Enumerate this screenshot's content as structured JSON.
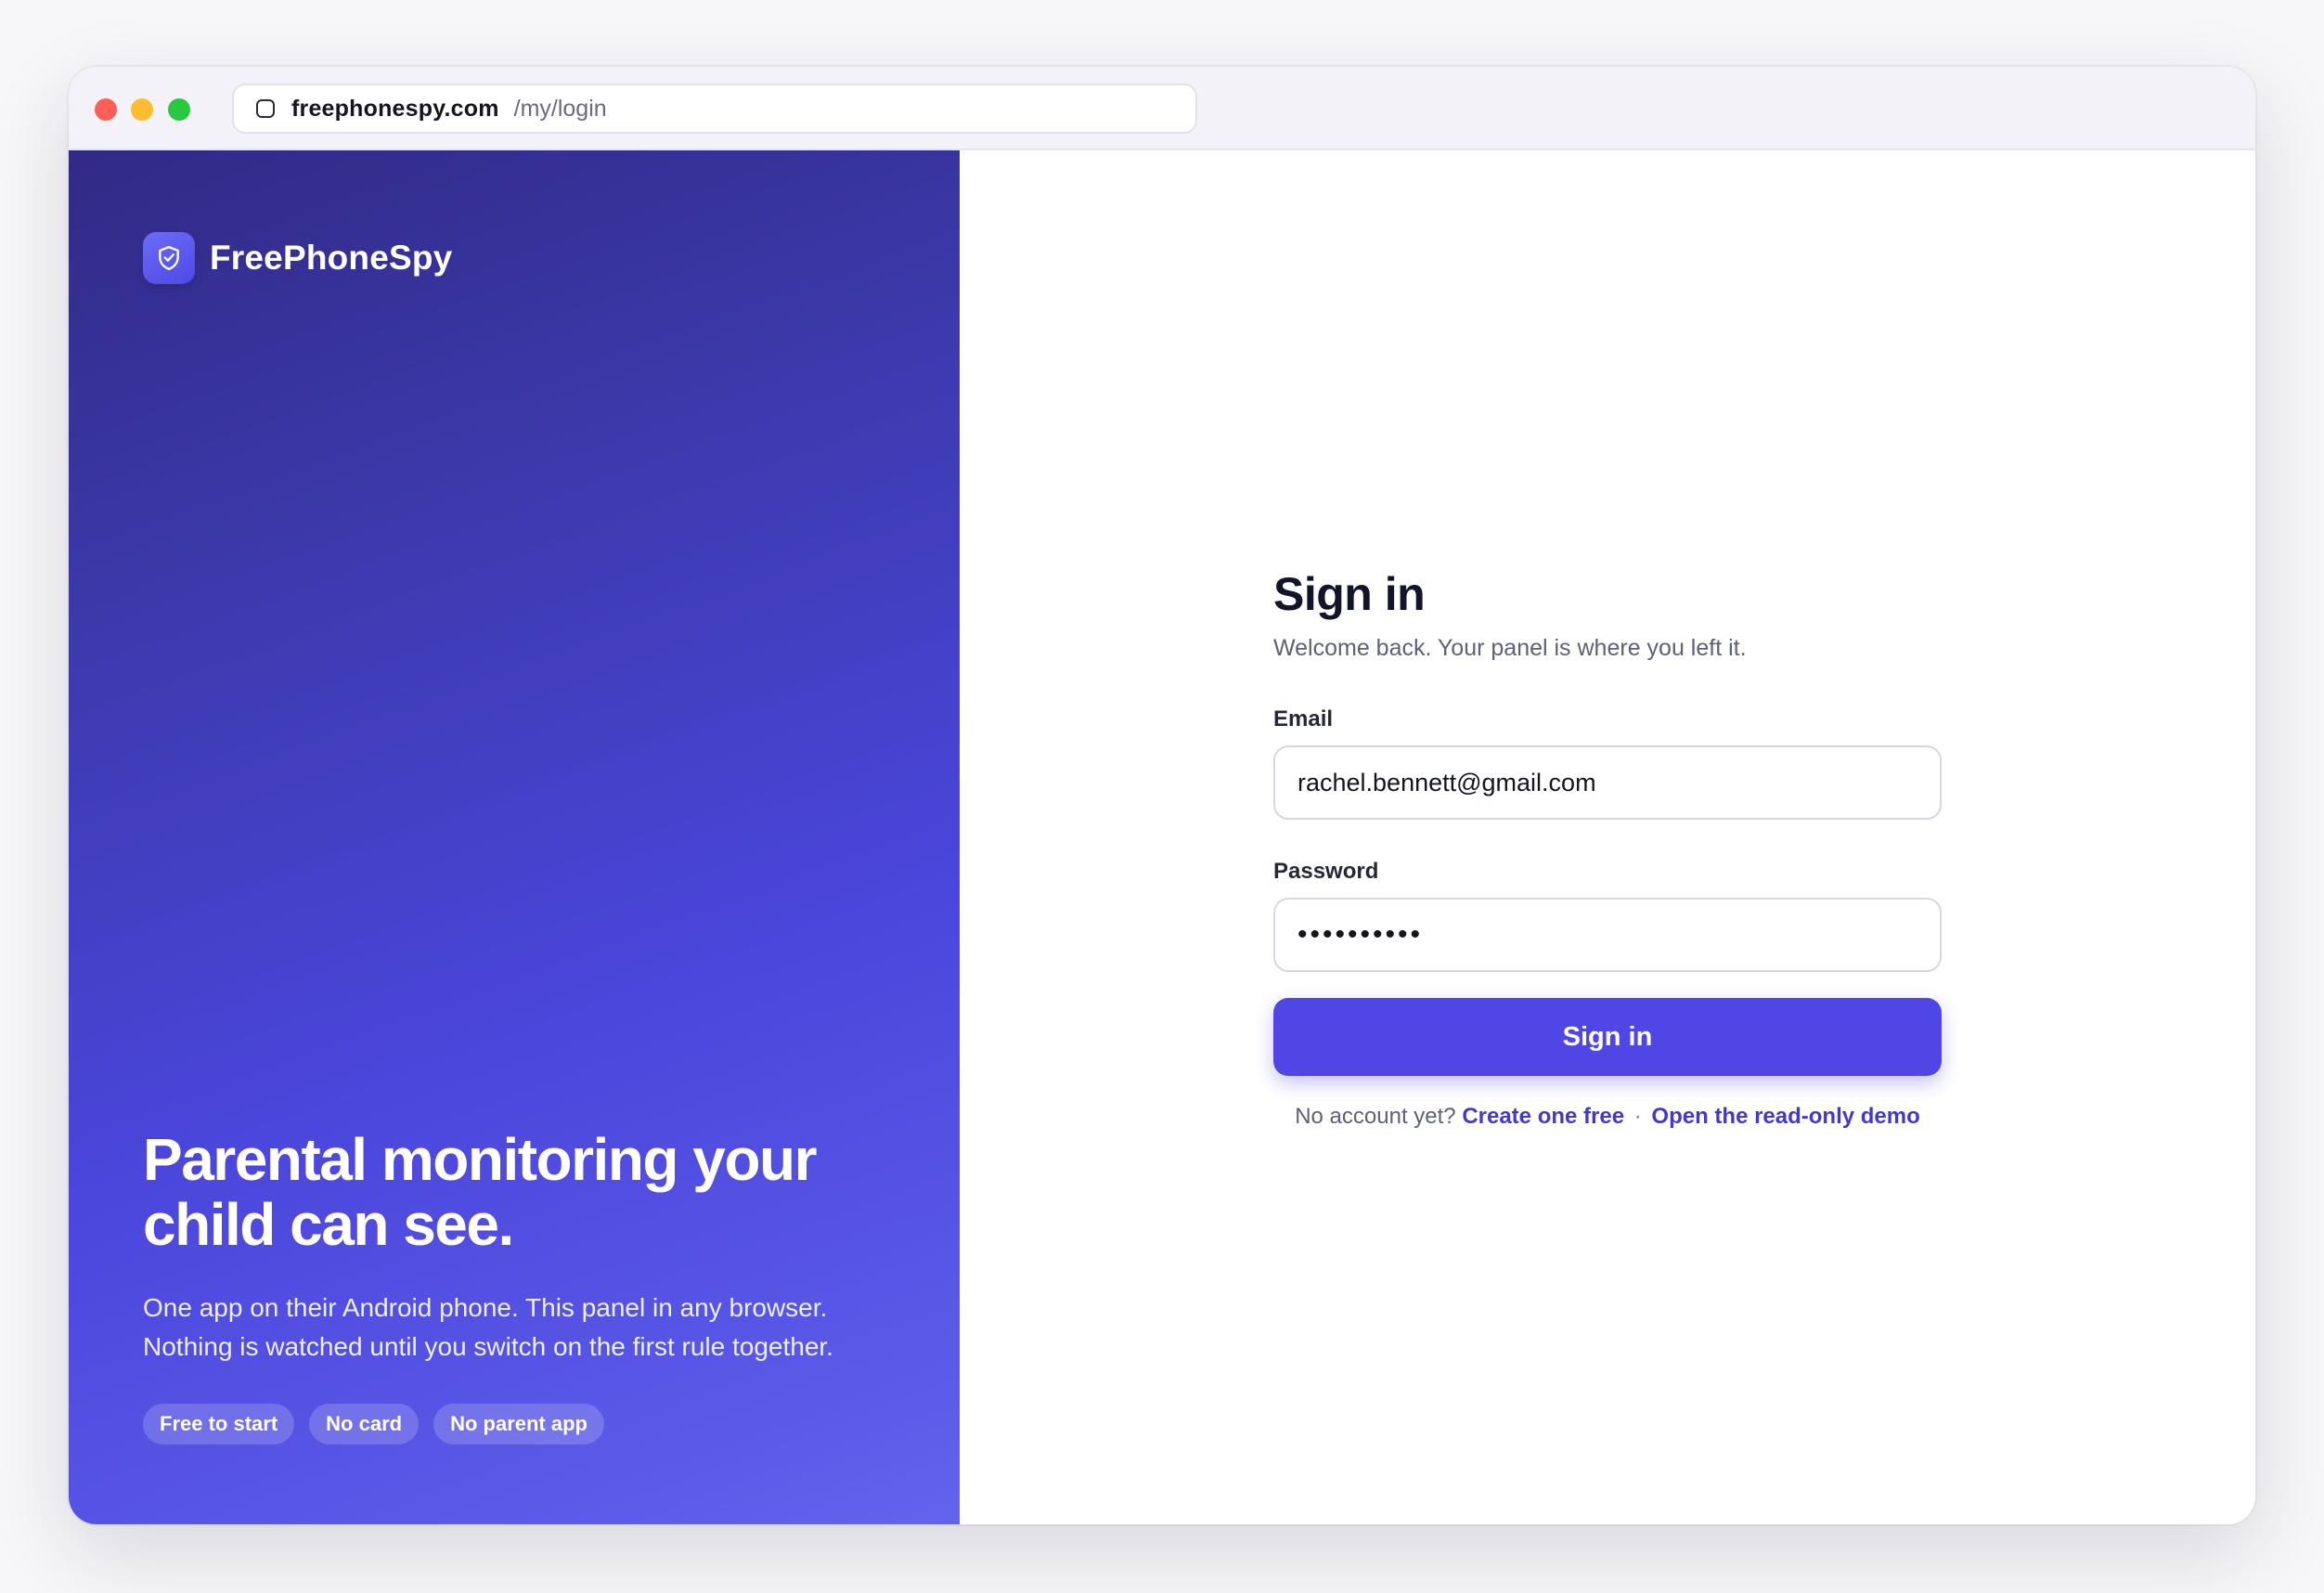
{
  "browser": {
    "url_domain": "freephonespy.com",
    "url_path": "/my/login"
  },
  "brand": {
    "name": "FreePhoneSpy",
    "logo_icon": "shield-check-icon"
  },
  "hero": {
    "title": "Parental monitoring your child can see.",
    "body": "One app on their Android phone. This panel in any browser. Nothing is watched until you switch on the first rule together.",
    "badges": [
      "Free to start",
      "No card",
      "No parent app"
    ]
  },
  "form": {
    "title": "Sign in",
    "subtitle": "Welcome back. Your panel is where you left it.",
    "email_label": "Email",
    "email_value": "rachel.bennett@gmail.com",
    "password_label": "Password",
    "password_value": "••••••••••",
    "submit_label": "Sign in",
    "no_account_text": "No account yet?",
    "create_link": "Create one free",
    "separator": "·",
    "demo_link": "Open the read-only demo"
  },
  "colors": {
    "primary": "#4f46e5",
    "link": "#4338ca",
    "panel_gradient_start": "#312a85",
    "panel_gradient_end": "#6363ee"
  }
}
